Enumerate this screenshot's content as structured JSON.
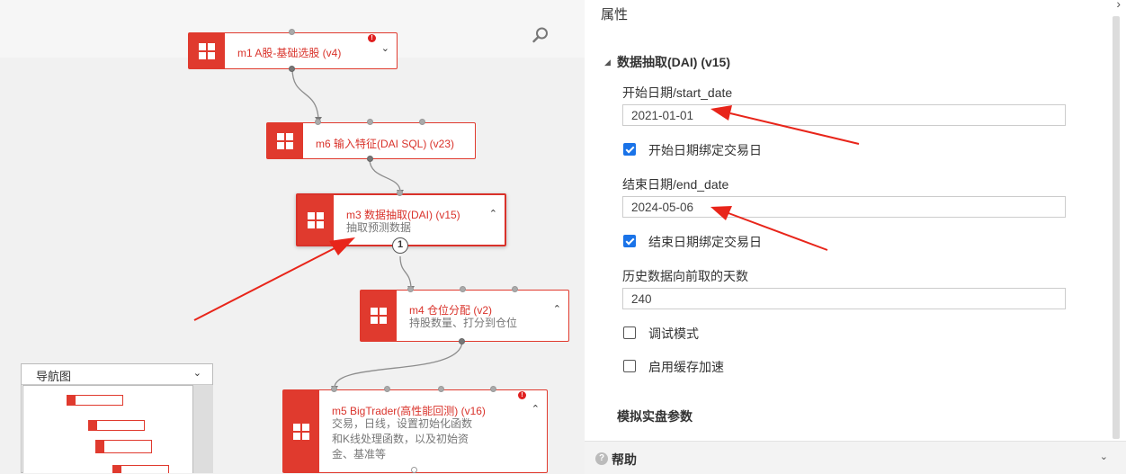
{
  "canvas": {
    "nodes": [
      {
        "title": "m1 A股-基础选股 (v4)",
        "subtitle": "",
        "chevron": "⌄",
        "warning": "!"
      },
      {
        "title": "m6 输入特征(DAI SQL) (v23)",
        "subtitle": "",
        "chevron": "",
        "warning": ""
      },
      {
        "title": "m3 数据抽取(DAI) (v15)",
        "subtitle": "抽取预测数据",
        "chevron": "⌃",
        "warning": ""
      },
      {
        "title": "m4 仓位分配 (v2)",
        "subtitle": "持股数量、打分到仓位",
        "chevron": "⌃",
        "warning": ""
      },
      {
        "title": "m5 BigTrader(高性能回测) (v16)",
        "subtitle_lines": [
          "交易，日线，设置初始化函数",
          "和K线处理函数，以及初始资",
          "金、基准等"
        ],
        "chevron": "⌃",
        "warning": "!"
      }
    ],
    "port_badge": "1",
    "search_icon": "search-icon",
    "minimap": {
      "title": "导航图",
      "chevron": "⌄"
    }
  },
  "panel": {
    "title": "属性",
    "collapse_icon": "chevron-right-icon",
    "section": {
      "title": "数据抽取(DAI) (v15)",
      "expanded": true
    },
    "fields": {
      "start_date": {
        "label": "开始日期/start_date",
        "value": "2021-01-01"
      },
      "start_bind": {
        "label": "开始日期绑定交易日",
        "checked": true
      },
      "end_date": {
        "label": "结束日期/end_date",
        "value": "2024-05-06"
      },
      "end_bind": {
        "label": "结束日期绑定交易日",
        "checked": true
      },
      "history_days": {
        "label": "历史数据向前取的天数",
        "value": "240"
      },
      "debug_mode": {
        "label": "调试模式",
        "checked": false
      },
      "cache": {
        "label": "启用缓存加速",
        "checked": false
      }
    },
    "section2": {
      "title": "模拟实盘参数"
    },
    "help": {
      "title": "帮助",
      "chevron": "⌄"
    }
  },
  "colors": {
    "accent": "#e03a2e",
    "checkbox": "#1a73e8",
    "annotation_arrow": "#e8251a"
  }
}
